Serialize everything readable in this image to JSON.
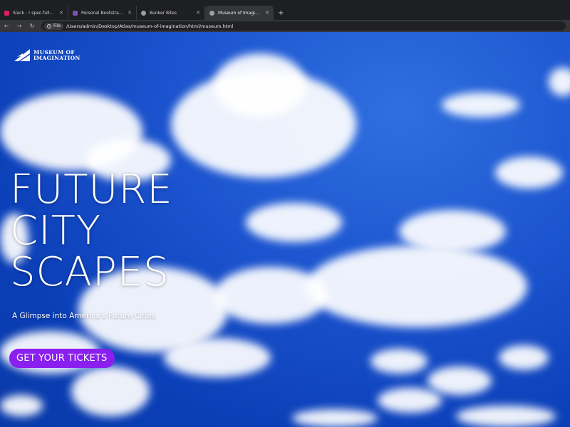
{
  "browser": {
    "tabs": [
      {
        "label": "Slack - ! spec-full_stack - A",
        "favicon_color": "#e01e5a",
        "active": false
      },
      {
        "label": "Personal Bootstrap Template",
        "favicon_color": "#7952b3",
        "active": false
      },
      {
        "label": "Bunker Bites",
        "favicon_color": "#9aa0a6",
        "active": false
      },
      {
        "label": "Museum of Imagination",
        "favicon_color": "#9aa0a6",
        "active": true
      }
    ],
    "new_tab_label": "+",
    "address": {
      "chip_label": "File",
      "url": "/Users/admin/Desktop/Atlas/museum-of-imagination/html/museum.html"
    }
  },
  "page": {
    "logo": {
      "line1": "MUSEUM OF",
      "line2": "IMAGINATION"
    },
    "hero": {
      "title_lines": [
        "FUTURE",
        "CITY",
        "SCAPES"
      ],
      "subtitle": "A Glimpse into America's Future Cities",
      "cta_label": "GET YOUR TICKETS"
    },
    "colors": {
      "sky": "#1c54cf",
      "cta": "#8a1ff0"
    }
  }
}
